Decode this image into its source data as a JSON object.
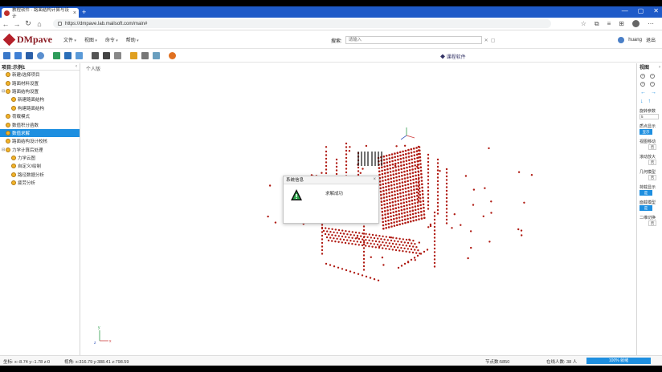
{
  "browser": {
    "tab_title": "教程软件 · 路面结构计算与设计",
    "url": "https://dmpave.lab.mailsoft.com/main#",
    "window_controls": [
      "—",
      "▢",
      "✕"
    ]
  },
  "app": {
    "logo_text": "DMpave",
    "menu": [
      "文件",
      "视图",
      "命令",
      "帮助"
    ],
    "search_label": "搜索:",
    "search_placeholder": "请输入",
    "user_name": "huang",
    "logout_label": "退出",
    "soft_link": "◆ 课程软件"
  },
  "left_panel": {
    "title": "项目:示例1",
    "collapse_icon": "‹",
    "items": [
      {
        "label": "新建/选择项目",
        "level": 0,
        "exp": "",
        "selected": false
      },
      {
        "label": "路面材料设置",
        "level": 0,
        "exp": "",
        "selected": false
      },
      {
        "label": "路面结构设置",
        "level": 0,
        "exp": "⊟",
        "selected": false
      },
      {
        "label": "新建路面结构",
        "level": 1,
        "exp": "",
        "selected": false
      },
      {
        "label": "构建路面结构",
        "level": 1,
        "exp": "",
        "selected": false
      },
      {
        "label": "荷载模式",
        "level": 0,
        "exp": "",
        "selected": false
      },
      {
        "label": "数值积分函数",
        "level": 0,
        "exp": "",
        "selected": false
      },
      {
        "label": "数值求解",
        "level": 0,
        "exp": "",
        "selected": true
      },
      {
        "label": "路面结构设计校核",
        "level": 0,
        "exp": "",
        "selected": false
      },
      {
        "label": "力学计算后处理",
        "level": 0,
        "exp": "⊟",
        "selected": false
      },
      {
        "label": "力学云图",
        "level": 1,
        "exp": "",
        "selected": false
      },
      {
        "label": "自定义/绘制",
        "level": 1,
        "exp": "",
        "selected": false
      },
      {
        "label": "路径数据分析",
        "level": 1,
        "exp": "",
        "selected": false
      },
      {
        "label": "疲劳分析",
        "level": 1,
        "exp": "",
        "selected": false
      }
    ]
  },
  "viewport": {
    "title": "个人版",
    "axes": {
      "x": "x",
      "y": "y",
      "z": "z"
    }
  },
  "dialog": {
    "title": "系统信息",
    "close": "×",
    "message": "求解成功"
  },
  "right_panel": {
    "title": "视图",
    "expand_icon": "›",
    "zoom_icons": [
      "+",
      "−",
      "+",
      "−"
    ],
    "arrow_icons": [
      "←",
      "→",
      "↓",
      "↑"
    ],
    "param_label": "旋转参数",
    "param_value": "5",
    "groups": [
      {
        "label": "质点显示",
        "value": "显示",
        "on": true
      },
      {
        "label": "视图移动",
        "value": "否",
        "on": false
      },
      {
        "label": "滚动放大",
        "value": "否",
        "on": false
      },
      {
        "label": "几何模型",
        "value": "否",
        "on": false
      },
      {
        "label": "荷载显示",
        "value": "是",
        "on": true
      },
      {
        "label": "面载模型",
        "value": "是",
        "on": true
      },
      {
        "label": "二维切换",
        "value": "否",
        "on": false
      }
    ]
  },
  "status_bar": {
    "coords": "坐标: x:-8.74  y:-1.78  z:0",
    "view": "视角:  x:316.79  y:388.41  z:798.59",
    "nodes": "节点数:5850",
    "online": "在线人数: 38 人",
    "progress_text": "100% 就绪",
    "progress_value": 1.0
  },
  "colors": {
    "accent": "#1e8fe0",
    "chrome": "#1e5ac8",
    "brand": "#8a1a22",
    "node_red": "#b01c14"
  }
}
